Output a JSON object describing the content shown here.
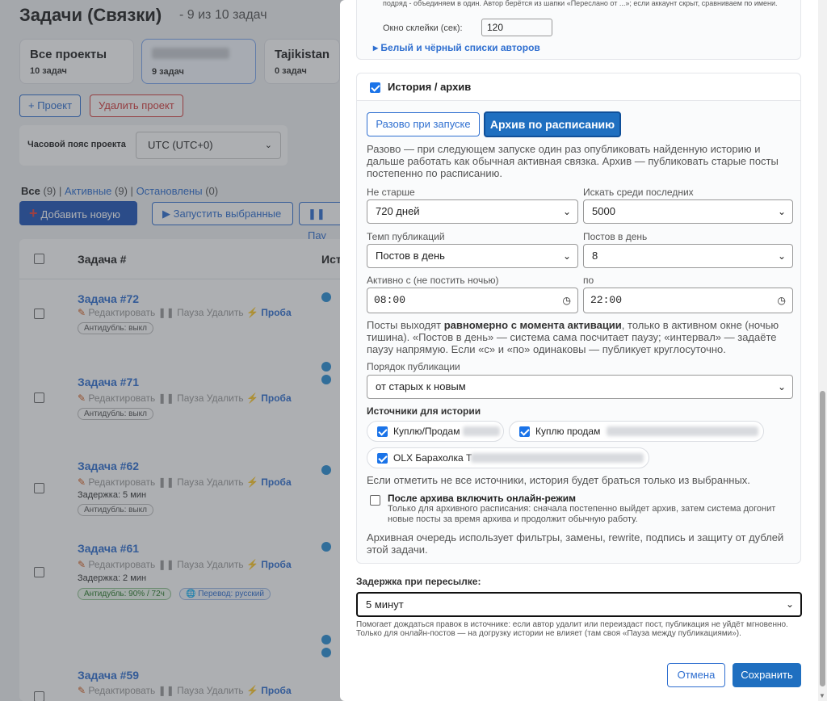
{
  "background": {
    "title": "Задачи (Связки)",
    "subtitle": "- 9 из 10 задач",
    "projects": [
      {
        "name": "Все проекты",
        "count": "10 задач"
      },
      {
        "name": "",
        "count": "9 задач"
      },
      {
        "name": "Tajikistan",
        "count": "0 задач"
      }
    ],
    "add_project": "+ Проект",
    "delete_project": "Удалить проект",
    "timezone_label": "Часовой пояс проекта",
    "timezone_value": "UTC (UTC+0)",
    "filters": {
      "all": "Все",
      "all_count": "(9)",
      "sep1": "|",
      "active": "Активные",
      "active_count": "(9)",
      "sep2": "|",
      "stopped": "Остановлены",
      "stopped_count": "(0)"
    },
    "add_new": "Добавить новую",
    "run_selected": "Запустить выбранные",
    "pause_label": "Пау",
    "table_headers": {
      "task": "Задача #",
      "source": "Ист"
    },
    "tasks": [
      {
        "name": "Задача #72",
        "edit": "Редактировать",
        "pause": "Пауза",
        "delete": "Удалить",
        "probe": "Проба",
        "delay": "",
        "antidup": "Антидубль: выкл",
        "translate": ""
      },
      {
        "name": "Задача #71",
        "edit": "Редактировать",
        "pause": "Пауза",
        "delete": "Удалить",
        "probe": "Проба",
        "delay": "",
        "antidup": "Антидубль: выкл",
        "translate": ""
      },
      {
        "name": "Задача #62",
        "edit": "Редактировать",
        "pause": "Пауза",
        "delete": "Удалить",
        "probe": "Проба",
        "delay": "Задержка: 5 мин",
        "antidup": "Антидубль: выкл",
        "translate": ""
      },
      {
        "name": "Задача #61",
        "edit": "Редактировать",
        "pause": "Пауза",
        "delete": "Удалить",
        "probe": "Проба",
        "delay": "Задержка: 2 мин",
        "antidup": "Антидубль: 90% / 72ч",
        "translate": "Перевод: русский"
      },
      {
        "name": "Задача #59",
        "edit": "Редактировать",
        "pause": "Пауза",
        "delete": "Удалить",
        "probe": "Проба",
        "delay": "",
        "antidup": "",
        "translate": ""
      }
    ]
  },
  "modal": {
    "top_note": "подряд - объединяем в один. Автор берётся из шапки «Переслано от ...»; если аккаунт скрыт, сравниваем по имени.",
    "merge_window_label": "Окно склейки (сек):",
    "merge_window_value": "120",
    "author_lists": "▸ Белый и чёрный списки авторов",
    "history": {
      "title": "История / архив",
      "tab_once": "Разово при запуске",
      "tab_schedule": "Архив по расписанию",
      "description": "Разово — при следующем запуске один раз опубликовать найденную историю и дальше работать как обычная активная связка. Архив — публиковать старые посты постепенно по расписанию.",
      "not_older_label": "Не старше",
      "not_older_value": "720 дней",
      "search_last_label": "Искать среди последних",
      "search_last_value": "5000",
      "rate_label": "Темп публикаций",
      "rate_value": "Постов в день",
      "per_day_label": "Постов в день",
      "per_day_value": "8",
      "active_from_label": "Активно с (не постить ночью)",
      "active_from_value": "08:00",
      "active_to_label": "по",
      "active_to_value": "22:00",
      "posts_note_a": "Посты выходят ",
      "posts_note_b": "равномерно с момента активации",
      "posts_note_c": ", только в активном окне (ночью тишина). «Постов в день» — система сама посчитает паузу; «интервал» — задаёте паузу напрямую. Если «с» и «по» одинаковы — публикует круглосуточно.",
      "order_label": "Порядок публикации",
      "order_value": "от старых к новым",
      "sources_title": "Источники для истории",
      "sources": [
        "Куплю/Продам",
        "Куплю продам",
        "OLX Барахолка Т"
      ],
      "sources_note": "Если отметить не все источники, история будет браться только из выбранных.",
      "after_archive_title": "После архива включить онлайн-режим",
      "after_archive_note": "Только для архивного расписания: сначала постепенно выйдет архив, затем система догонит новые посты за время архива и продолжит обычную работу.",
      "queue_note": "Архивная очередь использует фильтры, замены, rewrite, подпись и защиту от дублей этой задачи."
    },
    "delay_label": "Задержка при пересылке:",
    "delay_value": "5 минут",
    "delay_note": "Помогает дождаться правок в источнике: если автор удалит или переиздаст пост, публикация не уйдёт мгновенно. Только для онлайн-постов — на догрузку истории не влияет (там своя «Пауза между публикациями»).",
    "cancel": "Отмена",
    "save": "Сохранить"
  },
  "colors": {
    "accent": "#1f6fc0",
    "link": "#2f6fd0",
    "danger": "#d43d3d",
    "checkbox": "#1a73e8"
  }
}
